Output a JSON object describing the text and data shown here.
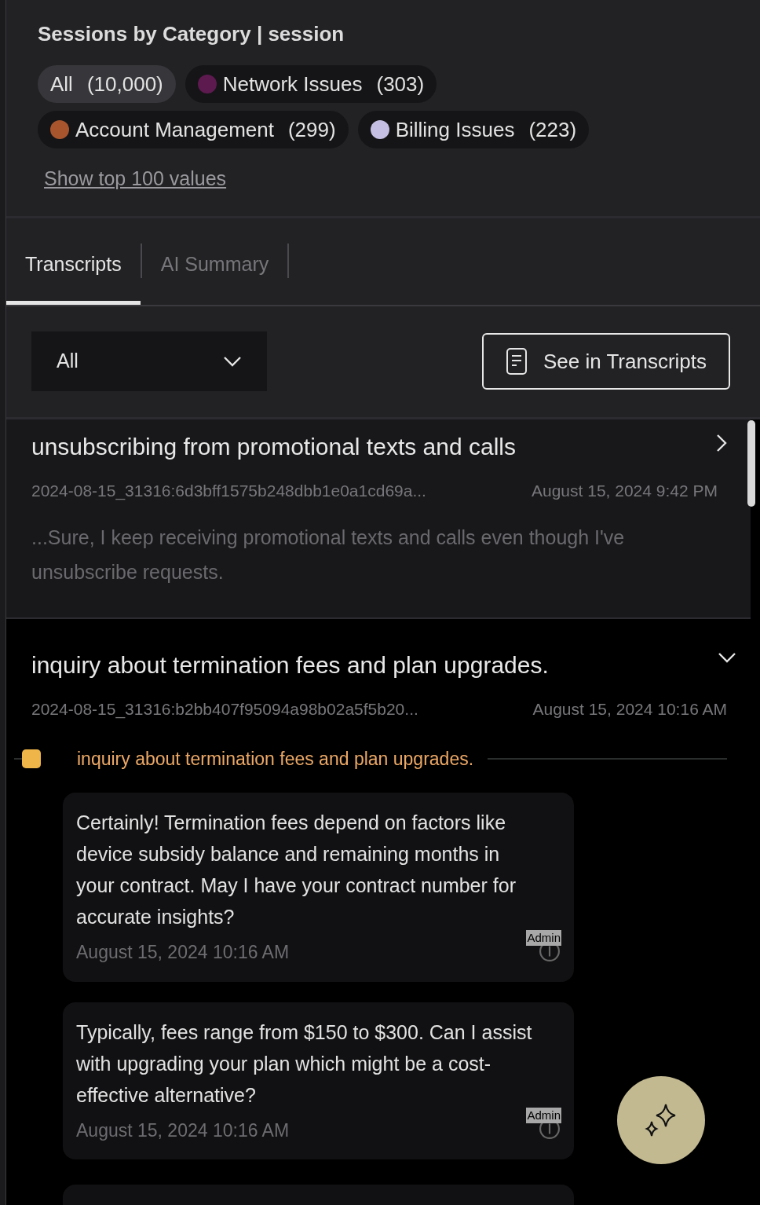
{
  "panel": {
    "title": "Sessions by Category | session",
    "chips": [
      {
        "kind": "all",
        "label": "All",
        "count": "(10,000)",
        "selected": true
      },
      {
        "kind": "category",
        "label": "Network Issues",
        "count": "(303)",
        "color": "#5c1a4f",
        "selected": false
      },
      {
        "kind": "category",
        "label": "Account Management",
        "count": "(299)",
        "color": "#a8552e",
        "selected": false
      },
      {
        "kind": "category",
        "label": "Billing Issues",
        "count": "(223)",
        "color": "#c4bfe3",
        "selected": false
      }
    ],
    "show_more_link": "Show top 100 values"
  },
  "tabs": [
    {
      "label": "Transcripts",
      "selected": true
    },
    {
      "label": "AI Summary",
      "selected": false
    }
  ],
  "filter": {
    "value": "All"
  },
  "see_button": "See in Transcripts",
  "sessions": [
    {
      "title": "unsubscribing from promotional texts and calls",
      "id": "2024-08-15_31316:6d3bff1575b248dbb1e0a1cd69a...",
      "time": "August 15, 2024 9:42 PM",
      "expanded": false,
      "snippet": "...Sure, I keep receiving promotional texts and calls even though I've unsubscribe requests."
    },
    {
      "title": "inquiry about termination fees and plan upgrades.",
      "id": "2024-08-15_31316:b2bb407f95094a98b02a5f5b20...",
      "time": "August 15, 2024 10:16 AM",
      "expanded": true,
      "topic": {
        "label": "inquiry about termination fees and plan upgrades.",
        "color": "#f0b548"
      },
      "messages": [
        {
          "text": "Certainly! Termination fees depend on factors like device subsidy balance and remaining months in your contract. May I have your contract number for accurate insights?",
          "time": "August 15, 2024 10:16 AM",
          "badge": "Admin"
        },
        {
          "text": "Typically, fees range from $150 to $300. Can I assist with upgrading your plan which might be a cost-effective alternative?",
          "time": "August 15, 2024 10:16 AM",
          "badge": "Admin"
        }
      ]
    }
  ]
}
